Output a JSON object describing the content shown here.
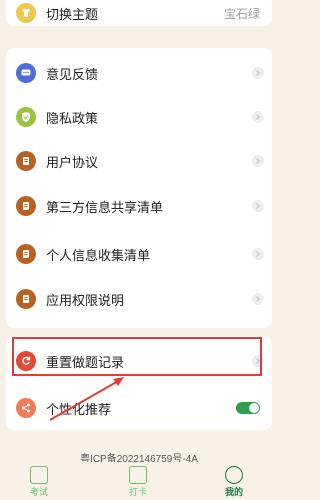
{
  "theme_row": {
    "label": "切换主题",
    "value": "宝石绿"
  },
  "menu": [
    {
      "label": "意见反馈"
    },
    {
      "label": "隐私政策"
    },
    {
      "label": "用户协议"
    },
    {
      "label": "第三方信息共享清单"
    },
    {
      "label": "个人信息收集清单"
    },
    {
      "label": "应用权限说明"
    }
  ],
  "reset_row": {
    "label": "重置做题记录"
  },
  "recommend_row": {
    "label": "个性化推荐",
    "enabled": true
  },
  "footer": {
    "icp": "粤ICP备2022146759号-4A"
  },
  "tabbar": {
    "tabs": [
      {
        "label": "考试"
      },
      {
        "label": "打卡"
      },
      {
        "label": "我的"
      }
    ],
    "active_index": 2
  },
  "colors": {
    "accent": "#2e9d50",
    "background": "#f8f1e5",
    "highlight_border": "#e23b3b"
  }
}
